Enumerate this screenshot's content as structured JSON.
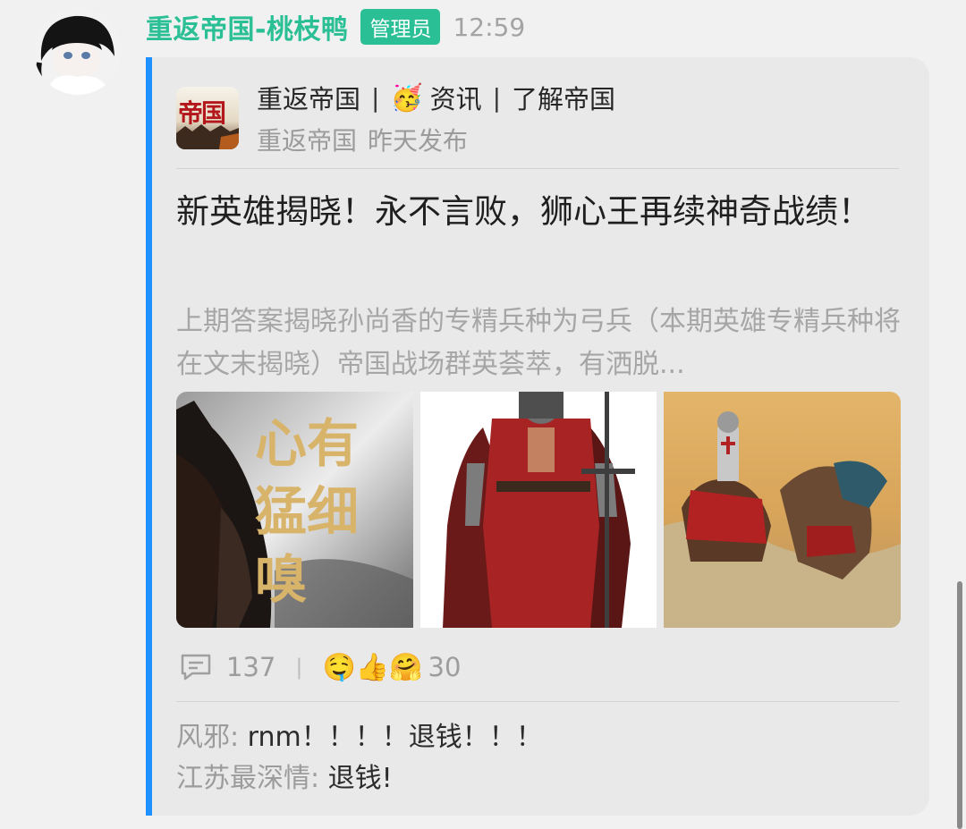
{
  "message": {
    "sender": "重返帝国-桃枝鸭",
    "role": "管理员",
    "time": "12:59"
  },
  "card": {
    "source_logo_text": "帝国",
    "source_title": [
      "重返帝国",
      "资讯",
      "了解帝国"
    ],
    "source_separator": "|",
    "source_name": "重返帝国",
    "published": "昨天发布",
    "title": "新英雄揭晓！永不言败，狮心王再续神奇战绩！",
    "excerpt": "上期答案揭晓孙尚香的专精兵种为弓兵（本期英雄专精兵种将在文末揭晓）帝国战场群英荟萃，有洒脱...",
    "thumbnail_text": "心有猛细嗅",
    "comment_count": "137",
    "reaction_count": "30",
    "comments": [
      {
        "user": "风邪:",
        "text": "rnm！！！！退钱！！！"
      },
      {
        "user": "江苏最深情:",
        "text": "退钱!"
      }
    ]
  },
  "icons": {
    "party_emoji": "🥳",
    "reactions": [
      "🤤",
      "👍",
      "🤗"
    ]
  },
  "colors": {
    "accent_green": "#2bbf95",
    "accent_blue": "#1e90ff",
    "card_bg": "#e9e9e9"
  }
}
